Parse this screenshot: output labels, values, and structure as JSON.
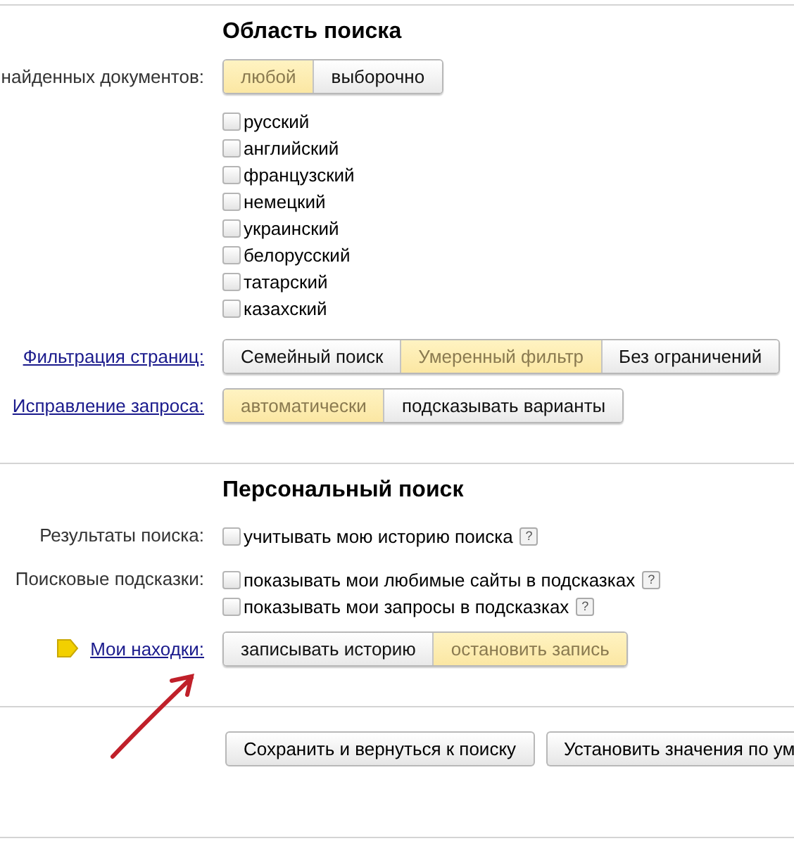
{
  "sections": [
    {
      "title": "Область поиска",
      "rows": [
        {
          "kind": "segmented",
          "label": "найденных документов:",
          "link": false,
          "marker": false,
          "options": [
            {
              "label": "любой",
              "selected": true
            },
            {
              "label": "выборочно",
              "selected": false
            }
          ]
        },
        {
          "kind": "checklist",
          "items": [
            {
              "label": "русский",
              "checked": false
            },
            {
              "label": "английский",
              "checked": false
            },
            {
              "label": "французский",
              "checked": false
            },
            {
              "label": "немецкий",
              "checked": false
            },
            {
              "label": "украинский",
              "checked": false
            },
            {
              "label": "белорусский",
              "checked": false
            },
            {
              "label": "татарский",
              "checked": false
            },
            {
              "label": "казахский",
              "checked": false
            }
          ]
        },
        {
          "kind": "segmented",
          "label": "Фильтрация страниц:",
          "link": true,
          "marker": false,
          "options": [
            {
              "label": "Семейный поиск",
              "selected": false
            },
            {
              "label": "Умеренный фильтр",
              "selected": true
            },
            {
              "label": "Без ограничений",
              "selected": false
            }
          ]
        },
        {
          "kind": "segmented",
          "label": "Исправление запроса:",
          "link": true,
          "marker": false,
          "options": [
            {
              "label": "автоматически",
              "selected": true
            },
            {
              "label": "подсказывать варианты",
              "selected": false
            }
          ]
        }
      ]
    },
    {
      "title": "Персональный поиск",
      "rows": [
        {
          "kind": "checklist",
          "label": "Результаты поиска:",
          "items": [
            {
              "label": "учитывать мою историю поиска",
              "checked": false,
              "help": "?"
            }
          ]
        },
        {
          "kind": "checklist",
          "label": "Поисковые подсказки:",
          "items": [
            {
              "label": "показывать мои любимые сайты в подсказках",
              "checked": false,
              "help": "?"
            },
            {
              "label": "показывать мои запросы в подсказках",
              "checked": false,
              "help": "?"
            }
          ]
        },
        {
          "kind": "segmented",
          "label": "Мои находки:",
          "link": true,
          "marker": true,
          "options": [
            {
              "label": "записывать историю",
              "selected": false
            },
            {
              "label": "остановить запись",
              "selected": true
            }
          ]
        }
      ]
    }
  ],
  "buttons": [
    "Сохранить и вернуться к поиску",
    "Установить значения по ум"
  ]
}
